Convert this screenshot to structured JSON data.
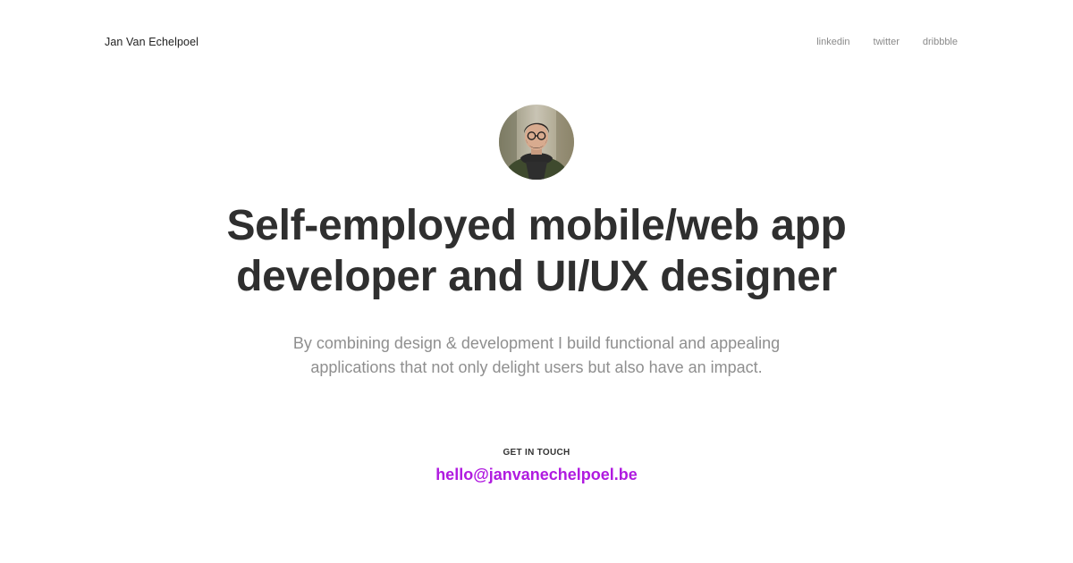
{
  "header": {
    "brand": "Jan Van Echelpoel",
    "links": [
      "linkedin",
      "twitter",
      "dribbble"
    ]
  },
  "hero": {
    "avatar_icon": "profile-photo",
    "headline_lines": [
      "Self-employed mobile/web app",
      "developer and UI/UX designer"
    ],
    "intro_lines": [
      "By combining design & development I build functional and appealing",
      "applications that not only delight users but also have an impact."
    ]
  },
  "contact": {
    "label": "GET IN TOUCH",
    "email": "hello@janvanechelpoel.be"
  },
  "colors": {
    "accent": "#b01be0",
    "heading": "#2f2f2f",
    "muted": "#8f8f8f"
  }
}
